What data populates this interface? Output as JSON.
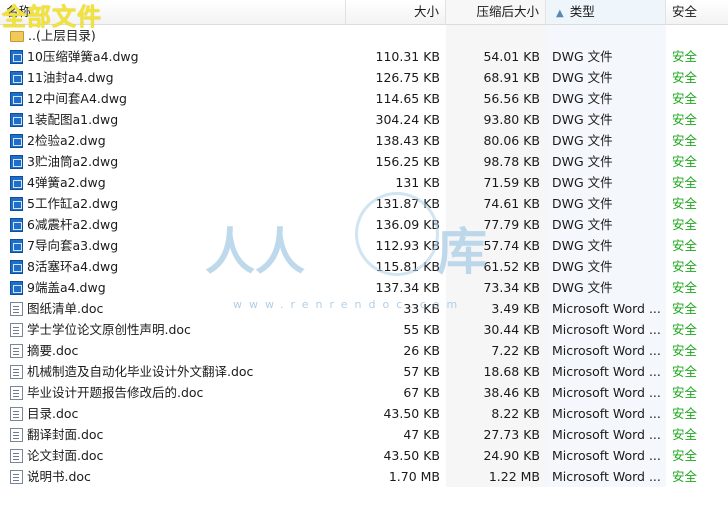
{
  "overlay_title": "全部文件",
  "columns": {
    "name": "名称",
    "size": "大小",
    "compressed": "压缩后大小",
    "type": "类型",
    "safety": "安全"
  },
  "parent_dir": "..(上层目录)",
  "files": [
    {
      "name": "10压缩弹簧a4.dwg",
      "size": "110.31 KB",
      "compressed": "54.01 KB",
      "type": "DWG 文件",
      "safety": "安全",
      "icon": "dwg-file-icon"
    },
    {
      "name": "11油封a4.dwg",
      "size": "126.75 KB",
      "compressed": "68.91 KB",
      "type": "DWG 文件",
      "safety": "安全",
      "icon": "dwg-file-icon"
    },
    {
      "name": "12中间套A4.dwg",
      "size": "114.65 KB",
      "compressed": "56.56 KB",
      "type": "DWG 文件",
      "safety": "安全",
      "icon": "dwg-file-icon"
    },
    {
      "name": "1装配图a1.dwg",
      "size": "304.24 KB",
      "compressed": "93.80 KB",
      "type": "DWG 文件",
      "safety": "安全",
      "icon": "dwg-file-icon"
    },
    {
      "name": "2检验a2.dwg",
      "size": "138.43 KB",
      "compressed": "80.06 KB",
      "type": "DWG 文件",
      "safety": "安全",
      "icon": "dwg-file-icon"
    },
    {
      "name": "3贮油筒a2.dwg",
      "size": "156.25 KB",
      "compressed": "98.78 KB",
      "type": "DWG 文件",
      "safety": "安全",
      "icon": "dwg-file-icon"
    },
    {
      "name": "4弹簧a2.dwg",
      "size": "131 KB",
      "compressed": "71.59 KB",
      "type": "DWG 文件",
      "safety": "安全",
      "icon": "dwg-file-icon"
    },
    {
      "name": "5工作缸a2.dwg",
      "size": "131.87 KB",
      "compressed": "74.61 KB",
      "type": "DWG 文件",
      "safety": "安全",
      "icon": "dwg-file-icon"
    },
    {
      "name": "6减震杆a2.dwg",
      "size": "136.09 KB",
      "compressed": "77.79 KB",
      "type": "DWG 文件",
      "safety": "安全",
      "icon": "dwg-file-icon"
    },
    {
      "name": "7导向套a3.dwg",
      "size": "112.93 KB",
      "compressed": "57.74 KB",
      "type": "DWG 文件",
      "safety": "安全",
      "icon": "dwg-file-icon"
    },
    {
      "name": "8活塞环a4.dwg",
      "size": "115.81 KB",
      "compressed": "61.52 KB",
      "type": "DWG 文件",
      "safety": "安全",
      "icon": "dwg-file-icon"
    },
    {
      "name": "9端盖a4.dwg",
      "size": "137.34 KB",
      "compressed": "73.34 KB",
      "type": "DWG 文件",
      "safety": "安全",
      "icon": "dwg-file-icon"
    },
    {
      "name": "图纸清单.doc",
      "size": "33 KB",
      "compressed": "3.49 KB",
      "type": "Microsoft Word ...",
      "safety": "安全",
      "icon": "word-doc-icon"
    },
    {
      "name": "学士学位论文原创性声明.doc",
      "size": "55 KB",
      "compressed": "30.44 KB",
      "type": "Microsoft Word ...",
      "safety": "安全",
      "icon": "word-doc-icon"
    },
    {
      "name": "摘要.doc",
      "size": "26 KB",
      "compressed": "7.22 KB",
      "type": "Microsoft Word ...",
      "safety": "安全",
      "icon": "word-doc-icon"
    },
    {
      "name": "机械制造及自动化毕业设计外文翻译.doc",
      "size": "57 KB",
      "compressed": "18.68 KB",
      "type": "Microsoft Word ...",
      "safety": "安全",
      "icon": "word-doc-icon"
    },
    {
      "name": "毕业设计开题报告修改后的.doc",
      "size": "67 KB",
      "compressed": "38.46 KB",
      "type": "Microsoft Word ...",
      "safety": "安全",
      "icon": "word-doc-icon"
    },
    {
      "name": "目录.doc",
      "size": "43.50 KB",
      "compressed": "8.22 KB",
      "type": "Microsoft Word ...",
      "safety": "安全",
      "icon": "word-doc-icon"
    },
    {
      "name": "翻译封面.doc",
      "size": "47 KB",
      "compressed": "27.73 KB",
      "type": "Microsoft Word ...",
      "safety": "安全",
      "icon": "word-doc-icon"
    },
    {
      "name": "论文封面.doc",
      "size": "43.50 KB",
      "compressed": "24.90 KB",
      "type": "Microsoft Word ...",
      "safety": "安全",
      "icon": "word-doc-icon"
    },
    {
      "name": "说明书.doc",
      "size": "1.70 MB",
      "compressed": "1.22 MB",
      "type": "Microsoft Word ...",
      "safety": "安全",
      "icon": "word-doc-icon"
    }
  ],
  "watermark": {
    "left": "人人",
    "right": "库",
    "url": "www.renrendoc.com"
  },
  "colors": {
    "safe_green": "#1aa81a",
    "dwg_icon": "#1f6fc9",
    "title_yellow": "#f2e23a"
  }
}
